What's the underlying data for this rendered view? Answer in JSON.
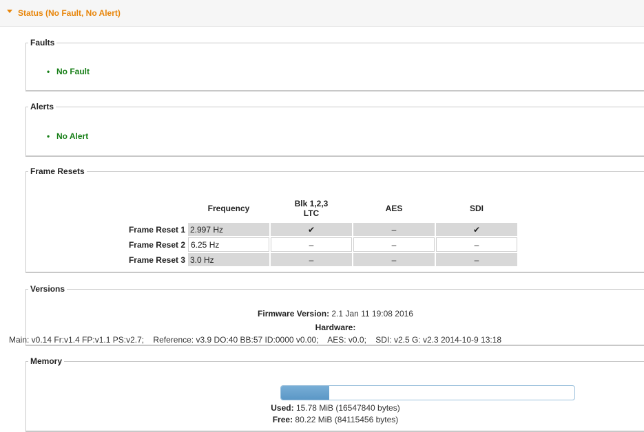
{
  "status": {
    "title": "Status (No Fault, No Alert)"
  },
  "faults": {
    "legend": "Faults",
    "items": [
      "No Fault"
    ]
  },
  "alerts": {
    "legend": "Alerts",
    "items": [
      "No Alert"
    ]
  },
  "frame_resets": {
    "legend": "Frame Resets",
    "columns": [
      "Frequency",
      "Blk 1,2,3\nLTC",
      "AES",
      "SDI"
    ],
    "rows": [
      {
        "label": "Frame Reset 1",
        "frequency": "2.997 Hz",
        "blk": "✔",
        "aes": "–",
        "sdi": "✔"
      },
      {
        "label": "Frame Reset 2",
        "frequency": "6.25 Hz",
        "blk": "–",
        "aes": "–",
        "sdi": "–"
      },
      {
        "label": "Frame Reset 3",
        "frequency": "3.0 Hz",
        "blk": "–",
        "aes": "–",
        "sdi": "–"
      }
    ]
  },
  "versions": {
    "legend": "Versions",
    "firmware_label": "Firmware Version:",
    "firmware_value": "2.1 Jan 11 19:08 2016",
    "hardware_label": "Hardware:",
    "hardware_detail": "Main: v0.14 Fr:v1.4 FP:v1.1 PS:v2.7;    Reference: v3.9 DO:40 BB:57 ID:0000 v0.00;    AES: v0.0;    SDI: v2.5 G: v2.3 2014-10-9 13:18"
  },
  "memory": {
    "legend": "Memory",
    "used_fraction": 0.164,
    "used_label": "Used:",
    "used_value": "15.78 MiB (16547840 bytes)",
    "free_label": "Free:",
    "free_value": "80.22 MiB (84115456 bytes)"
  }
}
